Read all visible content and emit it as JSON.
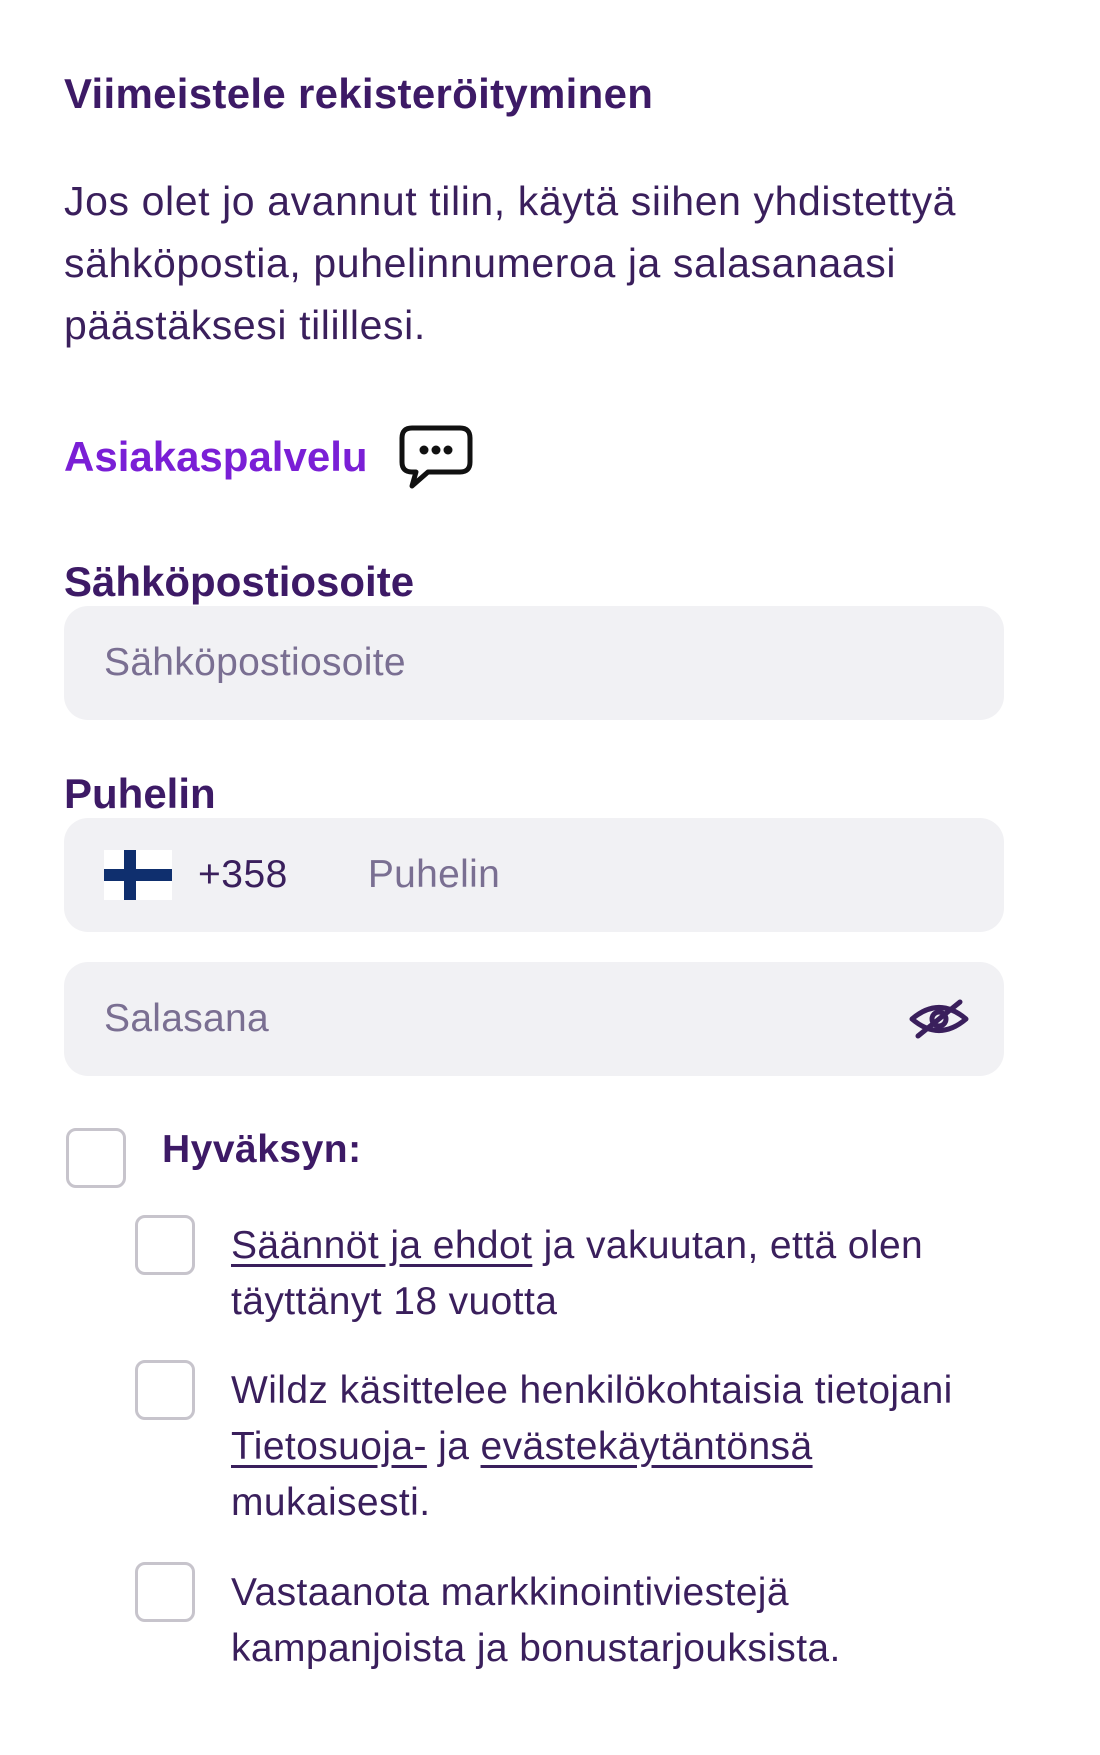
{
  "page": {
    "title": "Viimeistele rekisteröityminen",
    "intro": "Jos olet jo avannut tilin, käytä siihen yhdistettyä sähköpostia, puhelinnumeroa ja salasanaasi päästäksesi tilillesi."
  },
  "support": {
    "label": "Asiakaspalvelu",
    "icon": "chat-bubble-icon"
  },
  "email": {
    "label": "Sähköpostiosoite",
    "placeholder": "Sähköpostiosoite",
    "value": ""
  },
  "phone": {
    "label": "Puhelin",
    "country_flag": "finland-flag-icon",
    "dial_code": "+358",
    "placeholder": "Puhelin",
    "value": ""
  },
  "password": {
    "placeholder": "Salasana",
    "value": "",
    "toggle_icon": "eye-slash-icon"
  },
  "consent": {
    "accept_label": "Hyväksyn:",
    "accept_checked": false,
    "options": [
      {
        "checked": false,
        "link1": "Säännöt ja ehdot",
        "text1": " ja vakuutan, että olen täyttänyt 18 vuotta"
      },
      {
        "checked": false,
        "text1": "Wildz käsittelee henkilökohtaisia tietojani ",
        "link1": "Tietosuoja-",
        "text2": " ja ",
        "link2": "evästekäytäntönsä",
        "text3": " mukaisesti."
      },
      {
        "checked": false,
        "text1": "Vastaanota markkinointiviestejä kampanjoista ja bonustarjouksista."
      }
    ]
  },
  "colors": {
    "heading": "#3d1a66",
    "accent": "#7a1fd6",
    "input_bg": "#f1f1f4",
    "checkbox_border": "#c7c4cc"
  }
}
